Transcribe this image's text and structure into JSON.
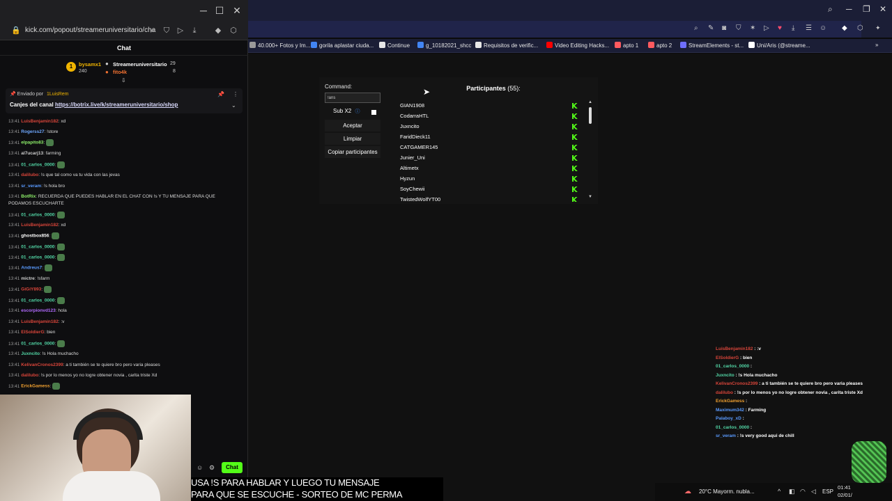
{
  "popup": {
    "url": "kick.com/popout/streameruniversitario/cha",
    "chat_header": "Chat",
    "prediction": {
      "left_user": "bysamx1",
      "left_points": "240",
      "right_user": "Streameruniversitario",
      "right_points": "29",
      "second_user": "fito4k",
      "second_points": "8"
    },
    "pinned": {
      "by": "Enviado por",
      "by_user": "1LuisRem",
      "prefix": "Canjes del canal",
      "link": "https://botrix.live/k/streameruniversitario/shop"
    },
    "messages": [
      {
        "t": "13:41",
        "u": "LuisBenjamin182",
        "c": "#d9453a",
        "m": ": xd",
        "e": false
      },
      {
        "t": "13:41",
        "u": "Rogerss27",
        "c": "#6fa8ff",
        "m": ": !store",
        "e": false
      },
      {
        "t": "13:41",
        "u": "elpapito83",
        "c": "#8ef06a",
        "m": ":",
        "e": true
      },
      {
        "t": "13:41",
        "u": "al7ucarj13",
        "c": "#cfcfcf",
        "m": ": farming",
        "e": false
      },
      {
        "t": "13:41",
        "u": "01_carlos_0000",
        "c": "#53d8a7",
        "m": ":",
        "e": true
      },
      {
        "t": "13:41",
        "u": "dalilubo",
        "c": "#d9453a",
        "m": ": !s que tal como va tu vida con las jevas",
        "e": false
      },
      {
        "t": "13:41",
        "u": "sr_veram",
        "c": "#5a9bff",
        "m": ": !s hola bro",
        "e": false
      },
      {
        "t": "13:41",
        "u": "BotRix",
        "c": "#8ef06a",
        "m": ": RECUERDA QUE PUEDES HABLAR EN EL CHAT CON !s Y TU MENSAJE PARA QUE",
        "e": false
      },
      {
        "t": "",
        "u": "",
        "c": "#fff",
        "m": "PODAMOS ESCUCHARTE",
        "e": false
      },
      {
        "t": "13:41",
        "u": "01_carlos_0000",
        "c": "#53d8a7",
        "m": ":",
        "e": true
      },
      {
        "t": "13:41",
        "u": "LuisBenjamin182",
        "c": "#d9453a",
        "m": ": xd",
        "e": false
      },
      {
        "t": "13:41",
        "u": "ghostbox856",
        "c": "#ffffff",
        "m": ":",
        "e": true
      },
      {
        "t": "13:41",
        "u": "01_carlos_0000",
        "c": "#53d8a7",
        "m": ":",
        "e": true
      },
      {
        "t": "13:41",
        "u": "01_carlos_0000",
        "c": "#53d8a7",
        "m": ":",
        "e": true
      },
      {
        "t": "13:41",
        "u": "Andreus7",
        "c": "#5a9bff",
        "m": ":",
        "e": true
      },
      {
        "t": "13:41",
        "u": "mictre",
        "c": "#cfcfcf",
        "m": ": !sfarm",
        "e": false
      },
      {
        "t": "13:41",
        "u": "GiGiY893",
        "c": "#d9453a",
        "m": ":",
        "e": true
      },
      {
        "t": "13:41",
        "u": "01_carlos_0000",
        "c": "#53d8a7",
        "m": ":",
        "e": true
      },
      {
        "t": "13:41",
        "u": "escorpionvd123",
        "c": "#b26bff",
        "m": ": hola",
        "e": false
      },
      {
        "t": "13:41",
        "u": "LuisBenjamin182",
        "c": "#d9453a",
        "m": ": :v",
        "e": false
      },
      {
        "t": "13:41",
        "u": "ElSoldierG",
        "c": "#d9453a",
        "m": ": bien",
        "e": false
      },
      {
        "t": "13:41",
        "u": "01_carlos_0000",
        "c": "#53d8a7",
        "m": ":",
        "e": true
      },
      {
        "t": "13:41",
        "u": "Juxncito",
        "c": "#53d8a7",
        "m": ": !s Hola muchacho",
        "e": false
      },
      {
        "t": "13:41",
        "u": "KelivanCronos2399",
        "c": "#d9453a",
        "m": ": a ti también se te quiere bro pero varia pleases",
        "e": false
      },
      {
        "t": "13:41",
        "u": "dalilubo",
        "c": "#d9453a",
        "m": ": !s por lo menos yo no logre obtener novia , carita triste Xd",
        "e": false
      },
      {
        "t": "13:41",
        "u": "ErickGamess",
        "c": "#f0a030",
        "m": ":",
        "e": true
      }
    ],
    "chat_button": "Chat"
  },
  "bookmarks": [
    {
      "label": "40.000+ Fotos y Im...",
      "color": "#9a9a9a"
    },
    {
      "label": "gorila aplastar ciuda...",
      "color": "#4285f4"
    },
    {
      "label": "Continue",
      "color": "#e6e6e6"
    },
    {
      "label": "g_10182021_shcc",
      "color": "#4285f4"
    },
    {
      "label": "Requisitos de verific...",
      "color": "#e6e6e6"
    },
    {
      "label": "Video Editing Hacks...",
      "color": "#ff0000"
    },
    {
      "label": "apto 1",
      "color": "#ff5a5f"
    },
    {
      "label": "apto 2",
      "color": "#ff5a5f"
    },
    {
      "label": "StreamElements - st...",
      "color": "#6f6fff"
    },
    {
      "label": "Uni/Aris (@streame...",
      "color": "#ffffff"
    }
  ],
  "giveaway": {
    "command_label": "Command:",
    "command_value": "!aris",
    "sub_label": "Sub X2",
    "buttons": [
      "Aceptar",
      "Limpiar",
      "Copiar participantes"
    ],
    "participants_label": "Participantes",
    "participants_count": "(55):",
    "participants": [
      "GIAN1908",
      "CodarraHTL",
      "Juxncito",
      "FaridDieck11",
      "CATGAMER145",
      "Junier_Uni",
      "Altimetx",
      "Hyzun",
      "SoyChewii",
      "TwistedWolfYT00"
    ]
  },
  "overlay_chat": [
    {
      "u": "LuisBenjamin182",
      "c": "#d9453a",
      "m": " : :v"
    },
    {
      "u": "ElSoldierG",
      "c": "#d9453a",
      "m": " : bien"
    },
    {
      "u": "01_carlos_0000",
      "c": "#53d8a7",
      "m": " :"
    },
    {
      "u": "Juxncito",
      "c": "#53d8a7",
      "m": " : !s Hola muchacho"
    },
    {
      "u": "KelivanCronos2399",
      "c": "#d9453a",
      "m": " : a ti también se te quiere bro pero varia pleases"
    },
    {
      "u": "dalilubo",
      "c": "#d9453a",
      "m": " : !s por lo menos yo no logre obtener novia , carita triste Xd"
    },
    {
      "u": "ErickGamess",
      "c": "#f0a030",
      "m": " :"
    },
    {
      "u": "Maximum342",
      "c": "#5a9bff",
      "m": " : Farming"
    },
    {
      "u": "Palaboy_xD",
      "c": "#5a9bff",
      "m": " :"
    },
    {
      "u": "01_carlos_0000",
      "c": "#53d8a7",
      "m": " :"
    },
    {
      "u": "sr_veram",
      "c": "#5a9bff",
      "m": " : !s very good aqui de chill"
    }
  ],
  "subtitles": [
    "USA !S PARA HABLAR Y LUEGO TU MENSAJE",
    "PARA QUE SE ESCUCHE - SORTEO DE MC PERMA"
  ],
  "taskbar": {
    "weather": "20°C  Mayorm. nubla...",
    "lang": "ESP",
    "time": "01:41",
    "date": "02/01/"
  },
  "colors": {
    "kick_green": "#53fc18",
    "browser_bg": "#1b1e36"
  }
}
